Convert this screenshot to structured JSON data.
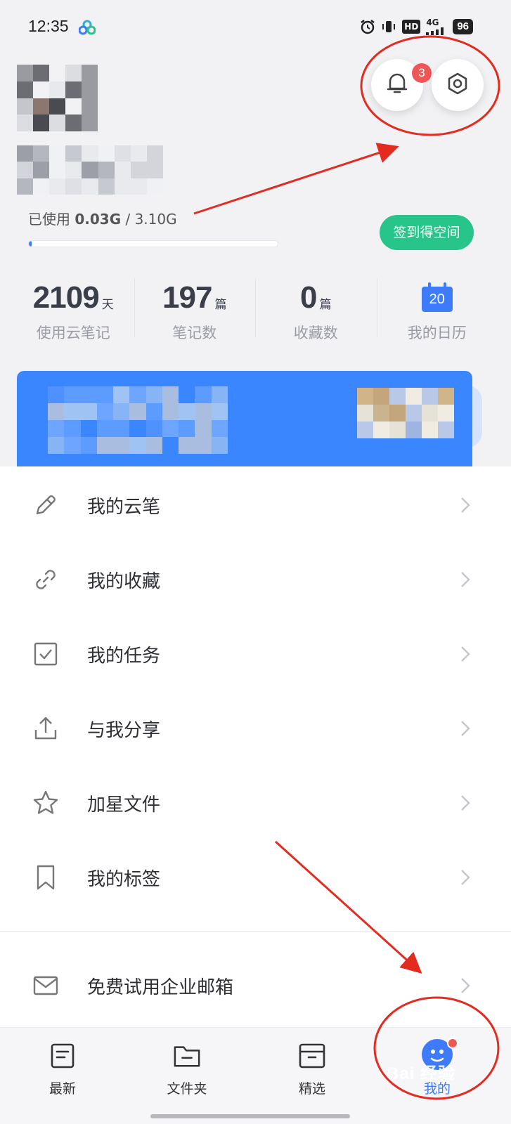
{
  "status_bar": {
    "time": "12:35",
    "hd": "HD",
    "network": "4G",
    "battery": "96"
  },
  "profile": {
    "storage_prefix": "已使用 ",
    "storage_used": "0.03G",
    "storage_sep": " / ",
    "storage_total": "3.10G",
    "storage_fraction": 0.01,
    "checkin_label": "签到得空间",
    "notification_count": "3"
  },
  "stats": [
    {
      "value": "2109",
      "unit": "天",
      "label": "使用云笔记"
    },
    {
      "value": "197",
      "unit": "篇",
      "label": "笔记数"
    },
    {
      "value": "0",
      "unit": "篇",
      "label": "收藏数"
    },
    {
      "calendar_day": "20",
      "label": "我的日历"
    }
  ],
  "menu": {
    "items": [
      {
        "label": "我的云笔",
        "icon": "pencil-icon"
      },
      {
        "label": "我的收藏",
        "icon": "link-icon"
      },
      {
        "label": "我的任务",
        "icon": "checkbox-icon"
      },
      {
        "label": "与我分享",
        "icon": "share-icon"
      },
      {
        "label": "加星文件",
        "icon": "star-icon"
      },
      {
        "label": "我的标签",
        "icon": "bookmark-icon"
      }
    ],
    "mail_label": "免费试用企业邮箱"
  },
  "bottom_nav": {
    "items": [
      {
        "label": "最新",
        "icon": "document-icon"
      },
      {
        "label": "文件夹",
        "icon": "folder-icon"
      },
      {
        "label": "精选",
        "icon": "inbox-icon"
      },
      {
        "label": "我的",
        "icon": "avatar-icon",
        "active": true
      }
    ]
  },
  "watermark": "Bai 经验",
  "colors": {
    "accent": "#3e7bfa",
    "green": "#27c58a",
    "badge_red": "#f05656",
    "annotation_red": "#e32b20"
  }
}
